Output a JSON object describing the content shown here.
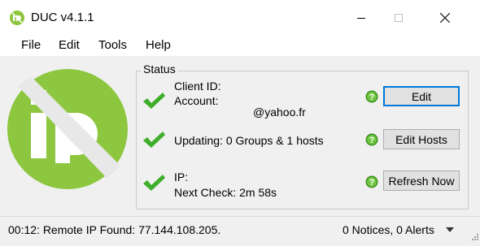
{
  "window": {
    "title": "DUC v4.1.1"
  },
  "menu": [
    "File",
    "Edit",
    "Tools",
    "Help"
  ],
  "status": {
    "legend": "Status",
    "account": {
      "client_id_label": "Client ID:",
      "account_label": "Account:",
      "account_value": "@yahoo.fr",
      "button": "Edit"
    },
    "hosts": {
      "label": "Updating: 0 Groups & 1 hosts",
      "button": "Edit Hosts"
    },
    "ip": {
      "ip_label": "IP:",
      "next_check": "Next Check: 2m 58s",
      "button": "Refresh Now"
    }
  },
  "statusbar": {
    "message": "00:12: Remote IP Found: 77.144.108.205.",
    "notices": "0 Notices, 0 Alerts"
  },
  "colors": {
    "brand_green": "#8dc63f",
    "check_green": "#3fae2a",
    "focus_blue": "#0078d7",
    "help_green": "#3d8f1f"
  },
  "icons": {
    "app": "ip-logo-icon",
    "check": "checkmark-icon",
    "help": "help-icon",
    "dropdown": "chevron-down-icon"
  }
}
